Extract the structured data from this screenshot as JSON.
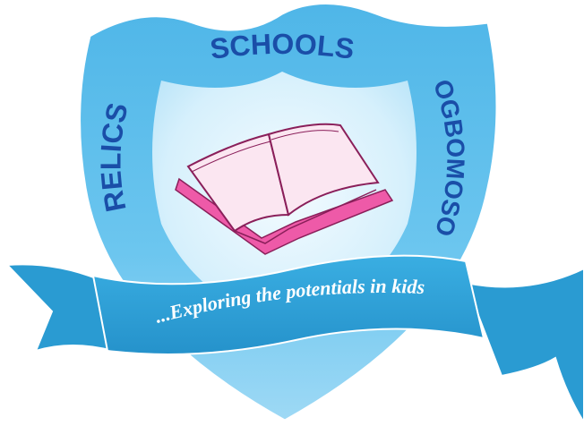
{
  "logo": {
    "top_word": "SCHOOLS",
    "left_word": "RELICS",
    "right_word": "OGBOMOSO",
    "motto": "...Exploring the potentials in kids"
  },
  "colors": {
    "shield_outer": "#5cc0ec",
    "shield_outer_light": "#9ad8f5",
    "shield_inner": "#cfeefb",
    "shield_inner_light": "#eaf8fe",
    "ribbon": "#2ea1d6",
    "ribbon_dark": "#1c7fb4",
    "text_blue": "#1a4ea8",
    "motto_text": "#ffffff",
    "book_pages": "#fbe6f1",
    "book_cover": "#ee5aa8",
    "book_outline": "#8a1f5a"
  },
  "icons": {
    "book": "open-book-icon",
    "shield": "shield-crest"
  }
}
